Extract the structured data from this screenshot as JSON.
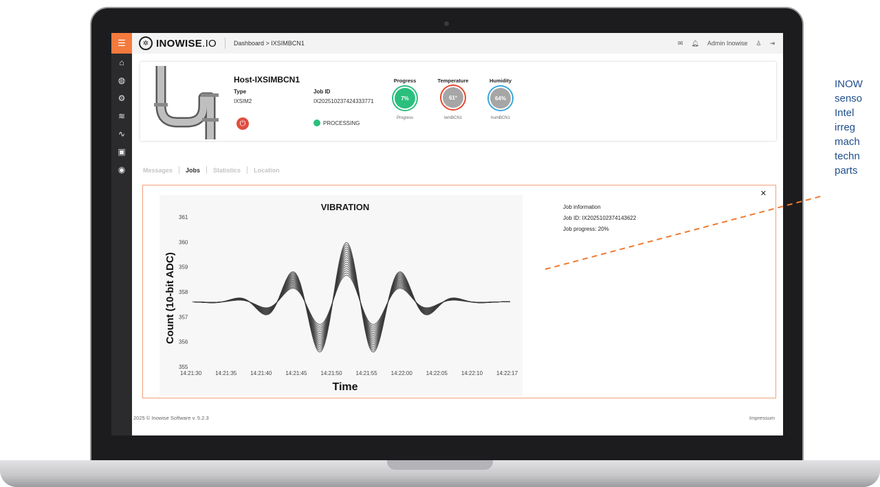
{
  "header": {
    "brand_bold": "INOWISE",
    "brand_rest": ".IO",
    "breadcrumb": "Dashboard > IXSIMBCN1",
    "user_name": "Admin Inowise"
  },
  "host": {
    "title": "Host-IXSIMBCN1",
    "type_label": "Type",
    "type_value": "IXSIM2",
    "jobid_label": "Job ID",
    "jobid_value": "IX202510237424333771",
    "status": "PROCESSING"
  },
  "gauges": [
    {
      "title": "Progress",
      "value": "7%",
      "sub": "Progress",
      "color": "#2bbf7e"
    },
    {
      "title": "Temperature",
      "value": "61º",
      "sub": "temBCN1",
      "color": "#a0a0a0"
    },
    {
      "title": "Humidity",
      "value": "64%",
      "sub": "humBCN1",
      "color": "#a0a0a0"
    }
  ],
  "tabs": [
    "Messages",
    "Jobs",
    "Statistics",
    "Location"
  ],
  "active_tab": "Jobs",
  "job_info": {
    "heading": "Job information",
    "job_id": "Job ID: IX2025102374143622",
    "job_progress": "Job progress: 20%"
  },
  "chart_data": {
    "type": "line",
    "title": "VIBRATION",
    "xlabel": "Time",
    "ylabel": "Count (10-bit ADC)",
    "ylim": [
      355,
      361
    ],
    "yticks": [
      "361",
      "360",
      "359",
      "358",
      "357",
      "356",
      "355"
    ],
    "xticks": [
      "14:21:30",
      "14:21:35",
      "14:21:40",
      "14:21:45",
      "14:21:50",
      "14:21:55",
      "14:22:00",
      "14:22:05",
      "14:22:10",
      "14:22:17"
    ],
    "series_count": 16,
    "baseline": 357.6,
    "peak_max": 360.3,
    "trough_min": 355.2,
    "color": "#3a3a3a"
  },
  "footer": {
    "copyright": "2025 © Inowise Software v. 5.2.3",
    "impressum": "Impressum"
  },
  "caption": {
    "lines": [
      "INOW",
      "senso",
      "Intel",
      "irreg",
      "mach",
      "techn",
      "parts"
    ],
    "color": "#1f4e8c"
  },
  "colors": {
    "accent": "#f47a3d",
    "sidebar": "#2b2b2d",
    "status_green": "#2bbf7e",
    "power_red": "#e04e40"
  }
}
